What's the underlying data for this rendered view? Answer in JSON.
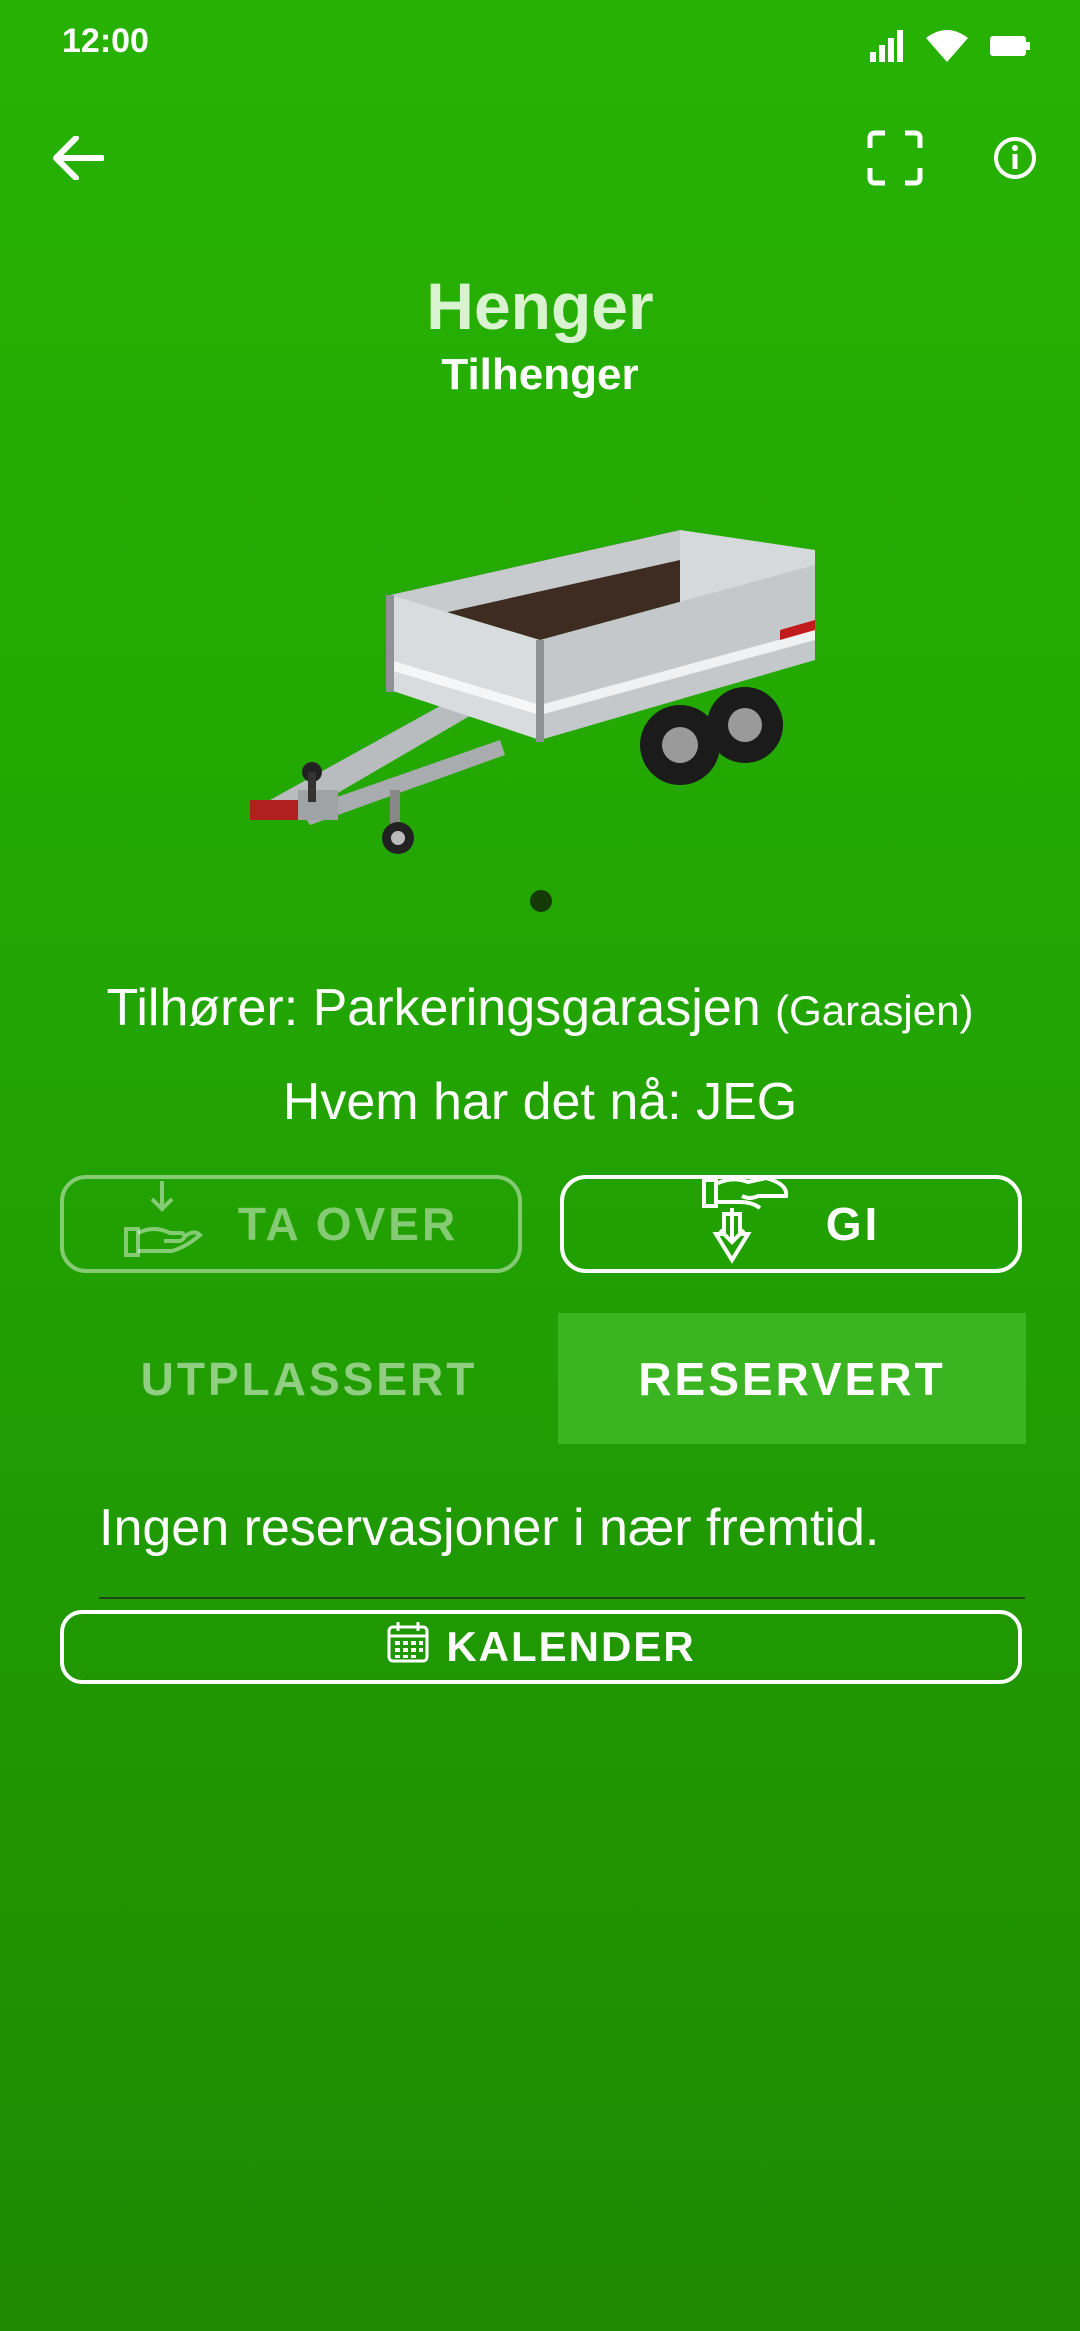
{
  "status_bar": {
    "time": "12:00",
    "icons": [
      "signal-icon",
      "wifi-icon",
      "battery-icon"
    ]
  },
  "topbar": {
    "icons": [
      "arrow-left-icon",
      "scan-frame-icon",
      "info-icon"
    ]
  },
  "item": {
    "name": "Henger",
    "type": "Tilhenger"
  },
  "carousel": {
    "image": "trailer-image",
    "page_count": 1,
    "current_page": 1
  },
  "owner": {
    "prefix": "Tilhører: ",
    "name": "Parkeringsgarasjen",
    "location": "(Garasjen)"
  },
  "holder": {
    "text": "Hvem har det nå: JEG"
  },
  "actions": {
    "take_over_label": "TA OVER",
    "give_label": "GI"
  },
  "tabs": {
    "items": [
      {
        "label": "UTPLASSERT",
        "selected": false
      },
      {
        "label": "RESERVERT",
        "selected": true
      }
    ]
  },
  "reservations": {
    "empty_message": "Ingen reservasjoner i nær fremtid.",
    "calendar_label": "KALENDER"
  },
  "colors": {
    "background": "#27b203",
    "selected_tab": "#3ab521",
    "text": "#ffffff"
  }
}
